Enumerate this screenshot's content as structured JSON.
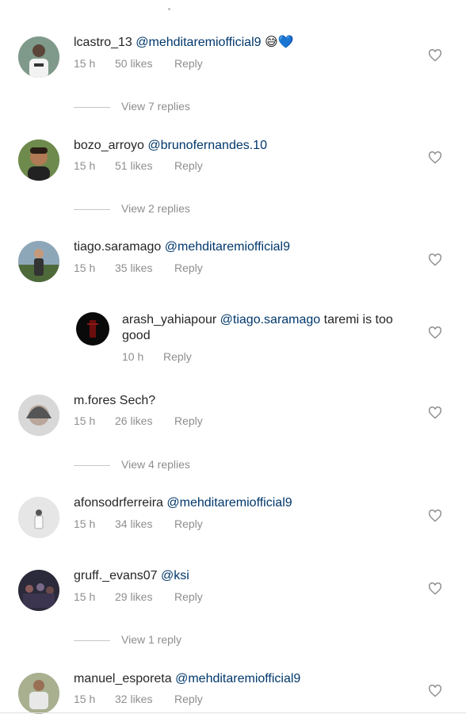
{
  "comments": [
    {
      "username": "lcastro_13",
      "mention": "@mehditaremiofficial9",
      "text": " 😅💙",
      "time": "15 h",
      "likes": "50 likes",
      "reply": "Reply"
    },
    {
      "username": "bozo_arroyo",
      "mention": "@brunofernandes.10",
      "text": "",
      "time": "15 h",
      "likes": "51 likes",
      "reply": "Reply"
    },
    {
      "username": "tiago.saramago",
      "mention": "@mehditaremiofficial9",
      "text": "",
      "time": "15 h",
      "likes": "35 likes",
      "reply": "Reply"
    },
    {
      "username": "arash_yahiapour",
      "mention": "@tiago.saramago",
      "text": " taremi is too good",
      "time": "10 h",
      "likes": "",
      "reply": "Reply"
    },
    {
      "username": "m.fores",
      "mention": "",
      "text": "Sech?",
      "time": "15 h",
      "likes": "26 likes",
      "reply": "Reply"
    },
    {
      "username": "afonsodrferreira",
      "mention": "@mehditaremiofficial9",
      "text": "",
      "time": "15 h",
      "likes": "34 likes",
      "reply": "Reply"
    },
    {
      "username": "gruff._evans07",
      "mention": "@ksi",
      "text": "",
      "time": "15 h",
      "likes": "29 likes",
      "reply": "Reply"
    },
    {
      "username": "manuel_esporeta",
      "mention": "@mehditaremiofficial9",
      "text": "",
      "time": "15 h",
      "likes": "32 likes",
      "reply": "Reply"
    }
  ],
  "view_replies": [
    "View 7 replies",
    "View 2 replies",
    "View 4 replies",
    "View 1 reply"
  ],
  "icons": {
    "like": "heart-outline-icon"
  },
  "colors": {
    "mention": "#00376b",
    "meta": "#8e8e8e",
    "text": "#262626"
  }
}
